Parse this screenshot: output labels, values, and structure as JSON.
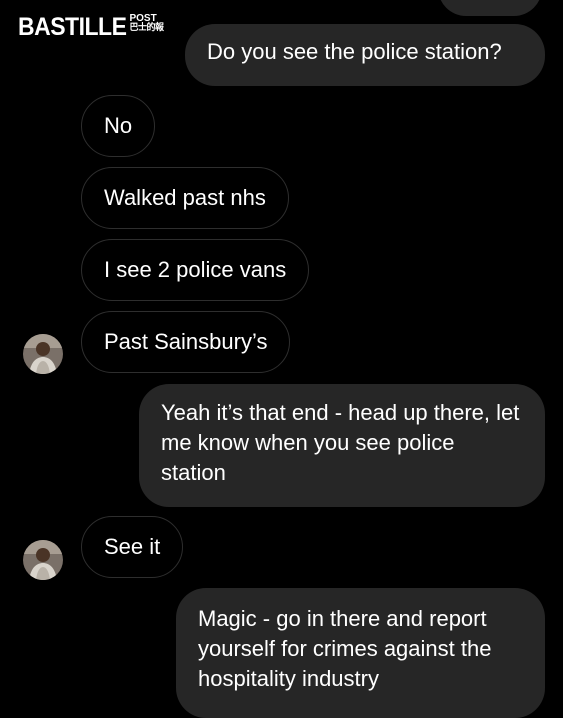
{
  "watermark": {
    "main": "BASTILLE",
    "post": "POST",
    "cn": "巴士的報"
  },
  "messages": {
    "q_police_station": "Do you see the police station?",
    "no": "No",
    "walked_past": "Walked past nhs",
    "see_vans": "I see 2 police vans",
    "past_sainsburys": "Past Sainsbury’s",
    "head_up": "Yeah it’s that end - head up there, let me know when you see police station",
    "see_it": "See it",
    "magic": "Magic - go in there and report yourself for crimes against the hospitality industry"
  },
  "colors": {
    "background": "#000000",
    "outgoing_bubble": "#262626",
    "incoming_border": "#2e2e2e",
    "text": "#ffffff"
  },
  "icons": {
    "contact_avatar": "person-photo-avatar"
  }
}
